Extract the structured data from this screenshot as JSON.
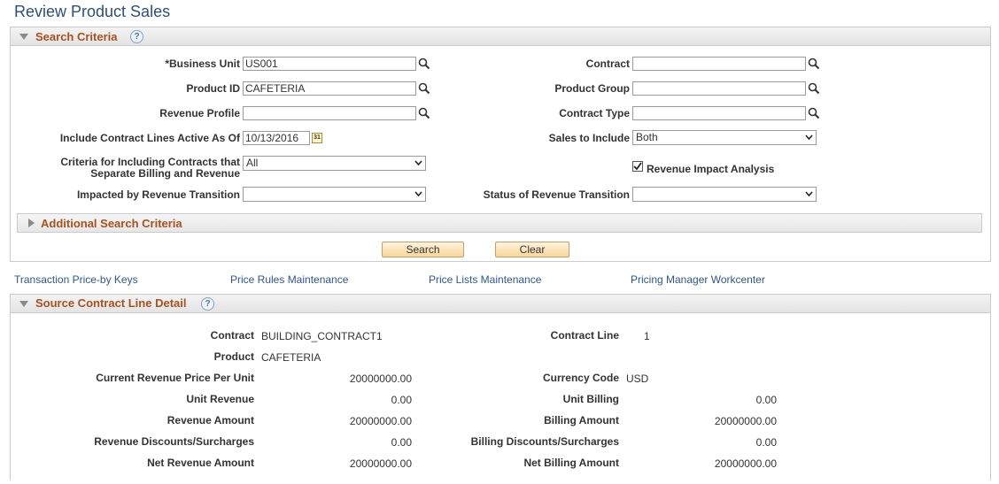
{
  "page": {
    "title": "Review Product Sales"
  },
  "search_criteria": {
    "title": "Search Criteria",
    "help_icon": "?",
    "business_unit": {
      "label": "*Business Unit",
      "value": "US001"
    },
    "product_id": {
      "label": "Product ID",
      "value": "CAFETERIA"
    },
    "revenue_profile": {
      "label": "Revenue Profile",
      "value": ""
    },
    "include_active": {
      "label": "Include Contract Lines Active As Of",
      "value": "10/13/2016",
      "calendar_icon": "31"
    },
    "criteria_including": {
      "label_line1": "Criteria for Including Contracts that",
      "label_line2": "Separate Billing and Revenue",
      "value": "All"
    },
    "impacted_transition": {
      "label": "Impacted by Revenue Transition",
      "value": ""
    },
    "contract": {
      "label": "Contract",
      "value": ""
    },
    "product_group": {
      "label": "Product Group",
      "value": ""
    },
    "contract_type": {
      "label": "Contract Type",
      "value": ""
    },
    "sales_to_include": {
      "label": "Sales to Include",
      "value": "Both"
    },
    "revenue_impact": {
      "label": "Revenue Impact Analysis",
      "checked": true
    },
    "status_transition": {
      "label": "Status of Revenue Transition",
      "value": ""
    },
    "additional_title": "Additional Search Criteria",
    "search_button": "Search",
    "clear_button": "Clear"
  },
  "links": [
    "Transaction Price-by Keys",
    "Price Rules Maintenance",
    "Price Lists Maintenance",
    "Pricing Manager Workcenter"
  ],
  "source_detail": {
    "title": "Source Contract Line Detail",
    "help_icon": "?",
    "contract": {
      "label": "Contract",
      "value": "BUILDING_CONTRACT1"
    },
    "product": {
      "label": "Product",
      "value": "CAFETERIA"
    },
    "current_price": {
      "label": "Current Revenue Price Per Unit",
      "value": "20000000.00"
    },
    "unit_revenue": {
      "label": "Unit Revenue",
      "value": "0.00"
    },
    "revenue_amount": {
      "label": "Revenue Amount",
      "value": "20000000.00"
    },
    "revenue_disc": {
      "label": "Revenue Discounts/Surcharges",
      "value": "0.00"
    },
    "net_revenue": {
      "label": "Net Revenue Amount",
      "value": "20000000.00"
    },
    "contract_line": {
      "label": "Contract Line",
      "value": "1"
    },
    "currency_code": {
      "label": "Currency Code",
      "value": "USD"
    },
    "unit_billing": {
      "label": "Unit Billing",
      "value": "0.00"
    },
    "billing_amount": {
      "label": "Billing Amount",
      "value": "20000000.00"
    },
    "billing_disc": {
      "label": "Billing Discounts/Surcharges",
      "value": "0.00"
    },
    "net_billing": {
      "label": "Net Billing Amount",
      "value": "20000000.00"
    }
  }
}
